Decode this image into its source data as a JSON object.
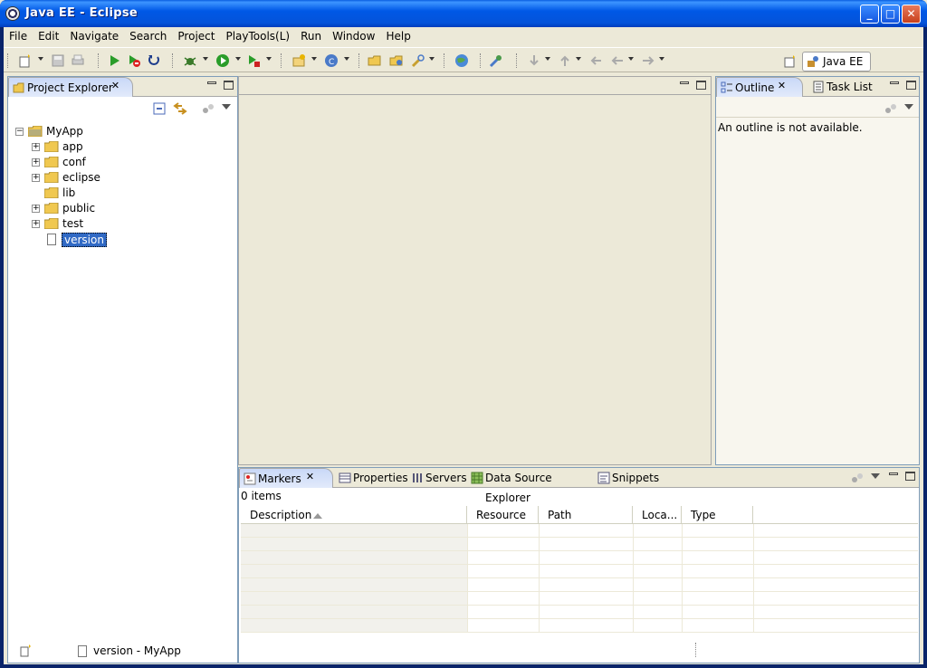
{
  "window": {
    "title": "Java EE - Eclipse"
  },
  "menu": [
    "File",
    "Edit",
    "Navigate",
    "Search",
    "Project",
    "PlayTools(L)",
    "Run",
    "Window",
    "Help"
  ],
  "perspective": {
    "label": "Java EE"
  },
  "project_explorer": {
    "tab_label": "Project Explorer",
    "root": "MyApp",
    "items": [
      {
        "label": "app",
        "expandable": true
      },
      {
        "label": "conf",
        "expandable": true
      },
      {
        "label": "eclipse",
        "expandable": true
      },
      {
        "label": "lib",
        "expandable": false
      },
      {
        "label": "public",
        "expandable": true
      },
      {
        "label": "test",
        "expandable": true
      },
      {
        "label": "version",
        "expandable": false,
        "selected": true
      }
    ]
  },
  "outline": {
    "tab_label": "Outline",
    "tasklist_label": "Task List",
    "message": "An outline is not available."
  },
  "bottom": {
    "tabs": [
      "Markers",
      "Properties",
      "Servers",
      "Data Source Explorer",
      "Snippets"
    ],
    "count": "0 items",
    "columns": [
      "Description",
      "Resource",
      "Path",
      "Loca...",
      "Type"
    ]
  },
  "status": {
    "text": "version - MyApp"
  },
  "colors": {
    "selection": "#316ac5",
    "titlebar": "#0453d9",
    "frame": "#ece9d8"
  }
}
